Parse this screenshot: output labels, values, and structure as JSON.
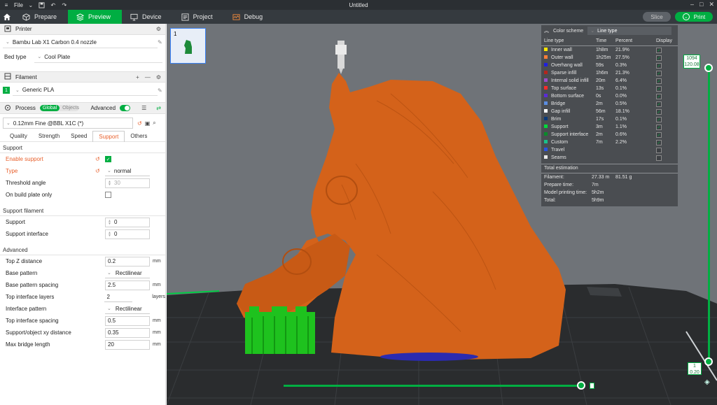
{
  "titlebar": {
    "file_label": "File",
    "title": "Untitled"
  },
  "nav": {
    "tabs": [
      {
        "label": "Prepare",
        "icon": "cube-outline-icon"
      },
      {
        "label": "Preview",
        "icon": "layers-icon"
      },
      {
        "label": "Device",
        "icon": "monitor-icon"
      },
      {
        "label": "Project",
        "icon": "project-icon"
      },
      {
        "label": "Debug",
        "icon": "debug-icon"
      }
    ],
    "slice_label": "Slice",
    "print_label": "Print"
  },
  "printer": {
    "section_label": "Printer",
    "name": "Bambu Lab X1 Carbon 0.4 nozzle",
    "bed_type_label": "Bed type",
    "bed_type_value": "Cool Plate"
  },
  "filament": {
    "section_label": "Filament",
    "slot": "1",
    "name": "Generic PLA"
  },
  "process": {
    "section_label": "Process",
    "toggle_global": "Global",
    "toggle_objects": "Objects",
    "advanced_label": "Advanced",
    "preset": "0.12mm Fine @BBL X1C (*)",
    "tabs": [
      "Quality",
      "Strength",
      "Speed",
      "Support",
      "Others"
    ]
  },
  "support": {
    "group_label": "Support",
    "enable_label": "Enable support",
    "type_label": "Type",
    "type_value": "normal",
    "threshold_label": "Threshold angle",
    "threshold_value": "30",
    "build_plate_label": "On build plate only"
  },
  "support_filament": {
    "group_label": "Support filament",
    "support_label": "Support",
    "support_value": "0",
    "interface_label": "Support interface",
    "interface_value": "0"
  },
  "advanced": {
    "group_label": "Advanced",
    "rows": [
      {
        "label": "Top Z distance",
        "value": "0.2",
        "unit": "mm",
        "kind": "spin"
      },
      {
        "label": "Base pattern",
        "value": "Rectilinear",
        "unit": "",
        "kind": "select"
      },
      {
        "label": "Base pattern spacing",
        "value": "2.5",
        "unit": "mm",
        "kind": "spin"
      },
      {
        "label": "Top interface layers",
        "value": "2",
        "unit": "layers",
        "kind": "spin"
      },
      {
        "label": "Interface pattern",
        "value": "Rectilinear",
        "unit": "",
        "kind": "select"
      },
      {
        "label": "Top interface spacing",
        "value": "0.5",
        "unit": "mm",
        "kind": "spin"
      },
      {
        "label": "Support/object xy distance",
        "value": "0.35",
        "unit": "mm",
        "kind": "spin"
      },
      {
        "label": "Max bridge length",
        "value": "20",
        "unit": "mm",
        "kind": "spin"
      }
    ]
  },
  "plate_thumb_number": "1",
  "legend": {
    "color_scheme_label": "Color scheme",
    "color_scheme_value": "Line type",
    "col_line_type": "Line type",
    "col_time": "Time",
    "col_percent": "Percent",
    "col_display": "Display",
    "rows": [
      {
        "name": "Inner wall",
        "time": "1h8m",
        "percent": "21.9%",
        "color": "#ffe600",
        "checked": true
      },
      {
        "name": "Outer wall",
        "time": "1h25m",
        "percent": "27.5%",
        "color": "#ff7d38",
        "checked": true
      },
      {
        "name": "Overhang wall",
        "time": "59s",
        "percent": "0.3%",
        "color": "#1f1fe0",
        "checked": true
      },
      {
        "name": "Sparse infill",
        "time": "1h6m",
        "percent": "21.3%",
        "color": "#b3261e",
        "checked": true
      },
      {
        "name": "Internal solid infill",
        "time": "20m",
        "percent": "6.4%",
        "color": "#9b4dca",
        "checked": true
      },
      {
        "name": "Top surface",
        "time": "13s",
        "percent": "0.1%",
        "color": "#ff2a2a",
        "checked": true
      },
      {
        "name": "Bottom surface",
        "time": "0s",
        "percent": "0.0%",
        "color": "#5a2bd6",
        "checked": true
      },
      {
        "name": "Bridge",
        "time": "2m",
        "percent": "0.5%",
        "color": "#5b8de0",
        "checked": true
      },
      {
        "name": "Gap infill",
        "time": "56m",
        "percent": "18.1%",
        "color": "#ffffff",
        "checked": true
      },
      {
        "name": "Brim",
        "time": "17s",
        "percent": "0.1%",
        "color": "#0a3a7a",
        "checked": true
      },
      {
        "name": "Support",
        "time": "3m",
        "percent": "1.1%",
        "color": "#00d93a",
        "checked": true
      },
      {
        "name": "Support interface",
        "time": "2m",
        "percent": "0.6%",
        "color": "#0a8a2a",
        "checked": true
      },
      {
        "name": "Custom",
        "time": "7m",
        "percent": "2.2%",
        "color": "#19c08a",
        "checked": true
      },
      {
        "name": "Travel",
        "time": "",
        "percent": "",
        "color": "#2b54e0",
        "checked": false
      },
      {
        "name": "Seams",
        "time": "",
        "percent": "",
        "color": "#e8e8e8",
        "checked": false
      }
    ],
    "total_label": "Total estimation",
    "filament_label": "Filament:",
    "filament_length": "27.33 m",
    "filament_weight": "81.51 g",
    "prepare_label": "Prepare time:",
    "prepare_value": "7m",
    "model_label": "Model printing time:",
    "model_value": "5h2m",
    "total_time_label": "Total:",
    "total_time_value": "5h9m"
  },
  "layer_slider": {
    "top_layer": "1094",
    "top_height": "120.08",
    "bottom_layer": "1",
    "bottom_height": "0.20"
  },
  "colors": {
    "accent": "#00ae42",
    "model": "#d4621a",
    "bed": "#2a2c2e"
  }
}
